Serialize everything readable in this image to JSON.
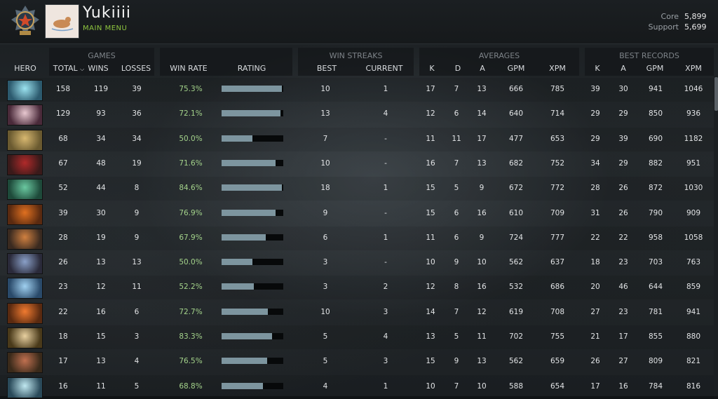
{
  "player": {
    "name": "Yukiiii",
    "menu_label": "MAIN MENU"
  },
  "mmr": {
    "core_label": "Core",
    "core_value": "5,899",
    "support_label": "Support",
    "support_value": "5,699"
  },
  "groups": {
    "games": "GAMES",
    "win_streaks": "WIN STREAKS",
    "averages": "AVERAGES",
    "best_records": "BEST RECORDS"
  },
  "columns": {
    "hero": "HERO",
    "total": "TOTAL",
    "wins": "WINS",
    "losses": "LOSSES",
    "win_rate": "WIN RATE",
    "rating": "RATING",
    "best": "BEST",
    "current": "CURRENT",
    "k": "K",
    "d": "D",
    "a": "A",
    "gpm": "GPM",
    "xpm": "XPM",
    "best_k": "K",
    "best_a": "A",
    "best_gpm": "GPM",
    "best_xpm": "XPM"
  },
  "sort_icon": "chevron-down-icon",
  "colors": {
    "win_rate_text": "#a4d38b",
    "rating_bar": "#7d959f",
    "menu_green": "#8ec63f"
  },
  "rows": [
    {
      "hero_icon": "hero-portrait-icon",
      "total": "158",
      "wins": "119",
      "losses": "39",
      "win_rate": "75.3%",
      "rating": 0.98,
      "best": "10",
      "current": "1",
      "k": "17",
      "d": "7",
      "a": "13",
      "gpm": "666",
      "xpm": "785",
      "best_k": "39",
      "best_a": "30",
      "best_gpm": "941",
      "best_xpm": "1046"
    },
    {
      "hero_icon": "hero-portrait-icon",
      "total": "129",
      "wins": "93",
      "losses": "36",
      "win_rate": "72.1%",
      "rating": 0.95,
      "best": "13",
      "current": "4",
      "k": "12",
      "d": "6",
      "a": "14",
      "gpm": "640",
      "xpm": "714",
      "best_k": "29",
      "best_a": "29",
      "best_gpm": "850",
      "best_xpm": "936"
    },
    {
      "hero_icon": "hero-portrait-icon",
      "total": "68",
      "wins": "34",
      "losses": "34",
      "win_rate": "50.0%",
      "rating": 0.5,
      "best": "7",
      "current": "-",
      "k": "11",
      "d": "11",
      "a": "17",
      "gpm": "477",
      "xpm": "653",
      "best_k": "29",
      "best_a": "39",
      "best_gpm": "690",
      "best_xpm": "1182"
    },
    {
      "hero_icon": "hero-portrait-icon",
      "total": "67",
      "wins": "48",
      "losses": "19",
      "win_rate": "71.6%",
      "rating": 0.87,
      "best": "10",
      "current": "-",
      "k": "16",
      "d": "7",
      "a": "13",
      "gpm": "682",
      "xpm": "752",
      "best_k": "34",
      "best_a": "29",
      "best_gpm": "882",
      "best_xpm": "951"
    },
    {
      "hero_icon": "hero-portrait-icon",
      "total": "52",
      "wins": "44",
      "losses": "8",
      "win_rate": "84.6%",
      "rating": 0.98,
      "best": "18",
      "current": "1",
      "k": "15",
      "d": "5",
      "a": "9",
      "gpm": "672",
      "xpm": "772",
      "best_k": "28",
      "best_a": "26",
      "best_gpm": "872",
      "best_xpm": "1030"
    },
    {
      "hero_icon": "hero-portrait-icon",
      "total": "39",
      "wins": "30",
      "losses": "9",
      "win_rate": "76.9%",
      "rating": 0.88,
      "best": "9",
      "current": "-",
      "k": "15",
      "d": "6",
      "a": "16",
      "gpm": "610",
      "xpm": "709",
      "best_k": "31",
      "best_a": "26",
      "best_gpm": "790",
      "best_xpm": "909"
    },
    {
      "hero_icon": "hero-portrait-icon",
      "total": "28",
      "wins": "19",
      "losses": "9",
      "win_rate": "67.9%",
      "rating": 0.72,
      "best": "6",
      "current": "1",
      "k": "11",
      "d": "6",
      "a": "9",
      "gpm": "724",
      "xpm": "777",
      "best_k": "22",
      "best_a": "22",
      "best_gpm": "958",
      "best_xpm": "1058"
    },
    {
      "hero_icon": "hero-portrait-icon",
      "total": "26",
      "wins": "13",
      "losses": "13",
      "win_rate": "50.0%",
      "rating": 0.5,
      "best": "3",
      "current": "-",
      "k": "10",
      "d": "9",
      "a": "10",
      "gpm": "562",
      "xpm": "637",
      "best_k": "18",
      "best_a": "23",
      "best_gpm": "703",
      "best_xpm": "763"
    },
    {
      "hero_icon": "hero-portrait-icon",
      "total": "23",
      "wins": "12",
      "losses": "11",
      "win_rate": "52.2%",
      "rating": 0.52,
      "best": "3",
      "current": "2",
      "k": "12",
      "d": "8",
      "a": "16",
      "gpm": "532",
      "xpm": "686",
      "best_k": "20",
      "best_a": "46",
      "best_gpm": "644",
      "best_xpm": "859"
    },
    {
      "hero_icon": "hero-portrait-icon",
      "total": "22",
      "wins": "16",
      "losses": "6",
      "win_rate": "72.7%",
      "rating": 0.75,
      "best": "10",
      "current": "3",
      "k": "14",
      "d": "7",
      "a": "12",
      "gpm": "619",
      "xpm": "708",
      "best_k": "27",
      "best_a": "23",
      "best_gpm": "781",
      "best_xpm": "941"
    },
    {
      "hero_icon": "hero-portrait-icon",
      "total": "18",
      "wins": "15",
      "losses": "3",
      "win_rate": "83.3%",
      "rating": 0.82,
      "best": "5",
      "current": "4",
      "k": "13",
      "d": "5",
      "a": "11",
      "gpm": "702",
      "xpm": "755",
      "best_k": "21",
      "best_a": "17",
      "best_gpm": "855",
      "best_xpm": "880"
    },
    {
      "hero_icon": "hero-portrait-icon",
      "total": "17",
      "wins": "13",
      "losses": "4",
      "win_rate": "76.5%",
      "rating": 0.74,
      "best": "5",
      "current": "3",
      "k": "15",
      "d": "9",
      "a": "13",
      "gpm": "562",
      "xpm": "659",
      "best_k": "26",
      "best_a": "27",
      "best_gpm": "809",
      "best_xpm": "821"
    },
    {
      "hero_icon": "hero-portrait-icon",
      "total": "16",
      "wins": "11",
      "losses": "5",
      "win_rate": "68.8%",
      "rating": 0.67,
      "best": "4",
      "current": "1",
      "k": "10",
      "d": "7",
      "a": "10",
      "gpm": "588",
      "xpm": "654",
      "best_k": "17",
      "best_a": "16",
      "best_gpm": "784",
      "best_xpm": "816"
    }
  ]
}
